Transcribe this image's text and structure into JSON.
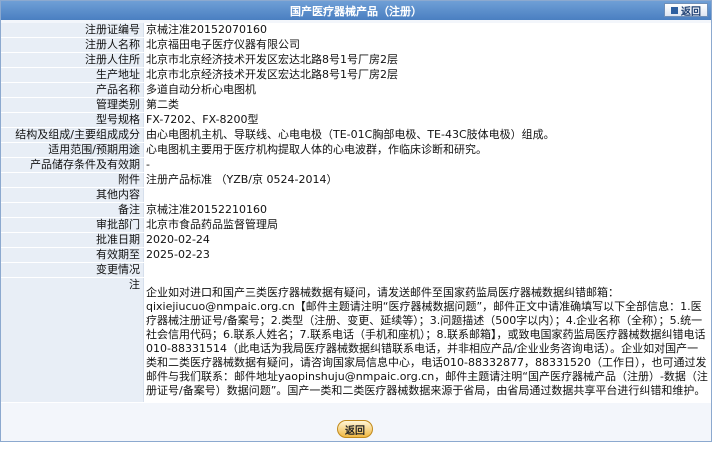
{
  "header": {
    "title": "国产医疗器械产品（注册）",
    "back_label": "返回"
  },
  "fields": [
    {
      "label": "注册证编号",
      "value": "京械注准20152070160"
    },
    {
      "label": "注册人名称",
      "value": "北京福田电子医疗仪器有限公司"
    },
    {
      "label": "注册人住所",
      "value": "北京市北京经济技术开发区宏达北路8号1号厂房2层"
    },
    {
      "label": "生产地址",
      "value": "北京市北京经济技术开发区宏达北路8号1号厂房2层"
    },
    {
      "label": "产品名称",
      "value": "多道自动分析心电图机"
    },
    {
      "label": "管理类别",
      "value": "第二类"
    },
    {
      "label": "型号规格",
      "value": "FX-7202、FX-8200型"
    },
    {
      "label": "结构及组成/主要组成成分",
      "value": "由心电图机主机、导联线、心电电极（TE-01C胸部电极、TE-43C肢体电极）组成。"
    },
    {
      "label": "适用范围/预期用途",
      "value": "心电图机主要用于医疗机构提取人体的心电波群，作临床诊断和研究。"
    },
    {
      "label": "产品储存条件及有效期",
      "value": "-"
    },
    {
      "label": "附件",
      "value": "注册产品标准 （YZB/京 0524-2014）"
    },
    {
      "label": "其他内容",
      "value": ""
    },
    {
      "label": "备注",
      "value": "京械注准20152210160"
    },
    {
      "label": "审批部门",
      "value": "北京市食品药品监督管理局"
    },
    {
      "label": "批准日期",
      "value": "2020-02-24"
    },
    {
      "label": "有效期至",
      "value": "2025-02-23"
    },
    {
      "label": "变更情况",
      "value": ""
    }
  ],
  "note": {
    "label": "注",
    "text": "企业如对进口和国产三类医疗器械数据有疑问，请发送邮件至国家药监局医疗器械数据纠错邮箱：qixiejiucuo@nmpaic.org.cn【邮件主题请注明“医疗器械数据问题”，邮件正文中请准确填写以下全部信息：1.医疗器械注册证号/备案号；2.类型（注册、变更、延续等）；3.问题描述（500字以内）；4.企业名称（全称）；5.统一社会信用代码；6.联系人姓名；7.联系电话（手机和座机）；8.联系邮箱】，或致电国家药监局医疗器械数据纠错电话010-88331514（此电话为我局医疗器械数据纠错联系电话，并非相应产品/企业业务咨询电话）。企业如对国产一类和二类医疗器械数据有疑问，请咨询国家局信息中心，电话010-88332877，88331520（工作日），也可通过发邮件与我们联系：邮件地址yaopinshuju@nmpaic.org.cn，邮件主题请注明“国产医疗器械产品（注册）-数据（注册证号/备案号）数据问题”。国产一类和二类医疗器械数据来源于省局，由省局通过数据共享平台进行纠错和维护。"
  },
  "footer": {
    "back_label": "返回"
  },
  "colors": {
    "header_bg": "#4a7fc1",
    "label_bg": "#e8eef6",
    "border": "#8ca9cf"
  }
}
